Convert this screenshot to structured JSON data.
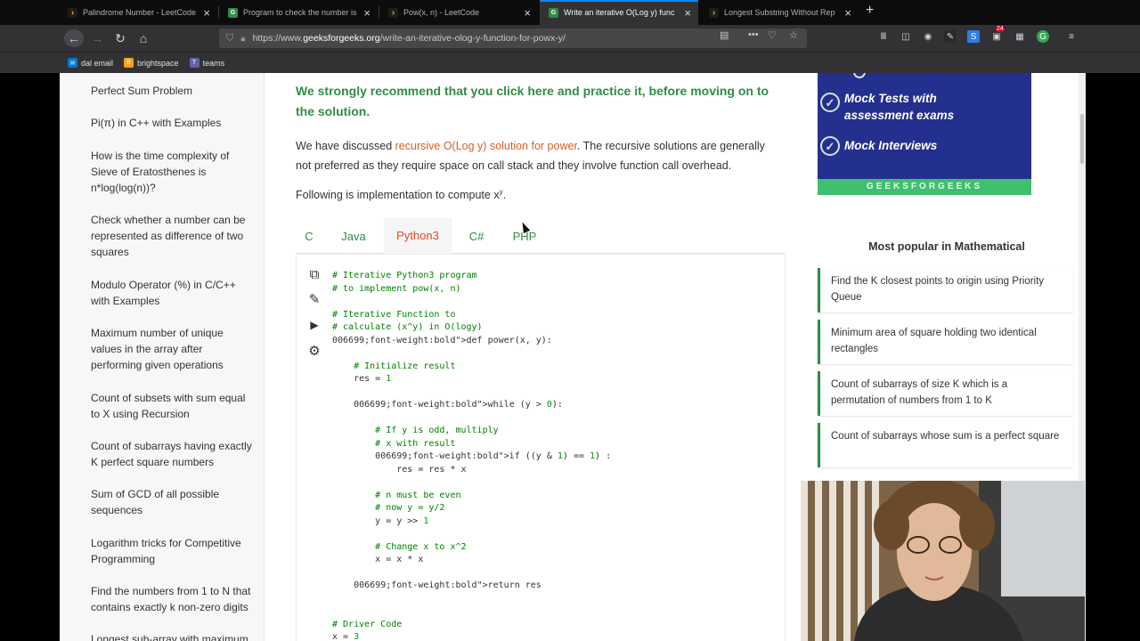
{
  "browser": {
    "tabs": [
      {
        "title": "Palindrome Number - LeetCode",
        "favicon": "leetcode-icon"
      },
      {
        "title": "Program to check the number is",
        "favicon": "gfg-icon"
      },
      {
        "title": "Pow(x, n) - LeetCode",
        "favicon": "leetcode-icon"
      },
      {
        "title": "Write an iterative O(Log y) func",
        "favicon": "gfg-icon"
      },
      {
        "title": "Longest Substring Without Rep",
        "favicon": "leetcode-icon"
      }
    ],
    "url_prefix": "https://www.",
    "url_host": "geeksforgeeks.org",
    "url_path": "/write-an-iterative-olog-y-function-for-powx-y/",
    "bookmarks": [
      "dal email",
      "brightspace",
      "teams"
    ],
    "badge_count": "24"
  },
  "sidebar": {
    "items": [
      "Perfect Sum Problem",
      "Pi(π) in C++ with Examples",
      "How is the time complexity of Sieve of Eratosthenes is n*log(log(n))?",
      "Check whether a number can be represented as difference of two squares",
      "Modulo Operator (%) in C/C++ with Examples",
      "Maximum number of unique values in the array after performing given operations",
      "Count of subsets with sum equal to X using Recursion",
      "Count of subarrays having exactly K perfect square numbers",
      "Sum of GCD of all possible sequences",
      "Logarithm tricks for Competitive Programming",
      "Find the numbers from 1 to N that contains exactly k non-zero digits",
      "Longest sub-array with maximum"
    ]
  },
  "article": {
    "recommend": "We strongly recommend that you click here and practice it, before moving on to the solution.",
    "para1_start": "We have discussed ",
    "para1_link": "recursive O(Log y) solution for power",
    "para1_end": ". The recursive solutions are generally not preferred as they require space on call stack and they involve function call overhead.",
    "para2": "Following is implementation to compute x",
    "para2_sup": "y",
    "para2_end": ".",
    "language_tabs": [
      "C",
      "Java",
      "Python3",
      "C#",
      "PHP"
    ],
    "active_tab": "Python3",
    "code_lines": [
      "# Iterative Python3 program",
      "# to implement pow(x, n)",
      "",
      "# Iterative Function to",
      "# calculate (x^y) in O(logy)",
      "def power(x, y):",
      "",
      "    # Initialize result",
      "    res = 1",
      "",
      "    while (y > 0):",
      "",
      "        # If y is odd, multiply",
      "        # x with result",
      "        if ((y & 1) == 1) :",
      "            res = res * x",
      "",
      "        # n must be even",
      "        # now y = y/2",
      "        y = y >> 1",
      "",
      "        # Change x to x^2",
      "        x = x * x",
      "",
      "    return res",
      "",
      "",
      "# Driver Code",
      "x = 3"
    ]
  },
  "promo": {
    "items": [
      "Mock Tests with assessment exams",
      "Mock Interviews"
    ],
    "footer": "GEEKSFORGEEKS"
  },
  "popular": {
    "title": "Most popular in Mathematical",
    "items": [
      "Find the K closest points to origin using Priority Queue",
      "Minimum area of square holding two identical rectangles",
      "Count of subarrays of size K which is a permutation of numbers from 1 to K",
      "Count of subarrays whose sum is a perfect square"
    ]
  },
  "colors": {
    "gfg_green": "#2f8d46",
    "link_orange": "#d55e2b",
    "active_tab": "#e34c26",
    "promo_blue": "#24308e"
  }
}
